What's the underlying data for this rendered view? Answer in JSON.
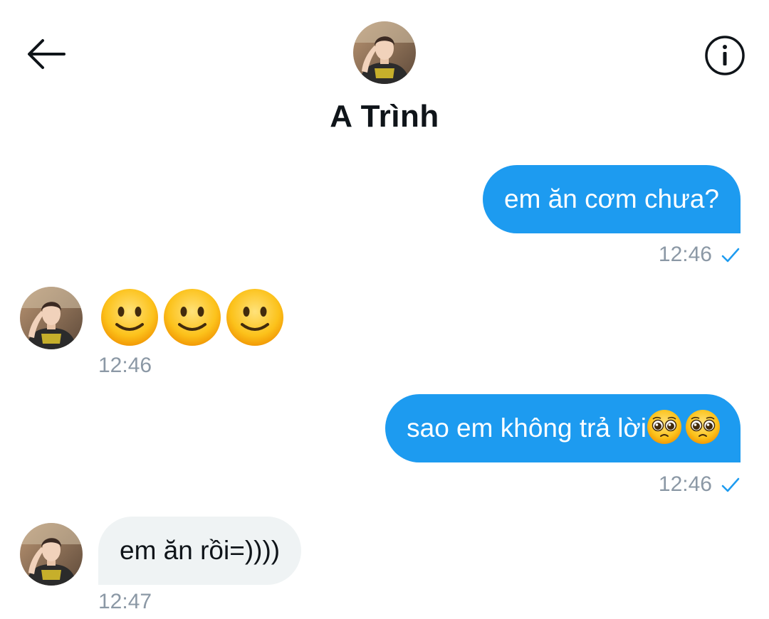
{
  "header": {
    "contact_name": "A Trình",
    "back_icon": "arrow-left-icon",
    "info_icon": "info-icon"
  },
  "messages": [
    {
      "direction": "out",
      "text": "em ăn cơm chưa?",
      "time": "12:46",
      "status_icon": "check-icon"
    },
    {
      "direction": "in",
      "emoji": [
        "slightly-smiling-face",
        "slightly-smiling-face",
        "slightly-smiling-face"
      ],
      "time": "12:46"
    },
    {
      "direction": "out",
      "text": "sao em không trả lời",
      "emoji": [
        "pleading-face",
        "pleading-face"
      ],
      "time": "12:46",
      "status_icon": "check-icon"
    },
    {
      "direction": "in",
      "text": "em ăn rồi=))))",
      "time": "12:47"
    }
  ],
  "colors": {
    "outgoing_bubble": "#1d9bf0",
    "incoming_bubble": "#eff3f4",
    "timestamp": "#8b98a5",
    "check": "#1d9bf0"
  }
}
